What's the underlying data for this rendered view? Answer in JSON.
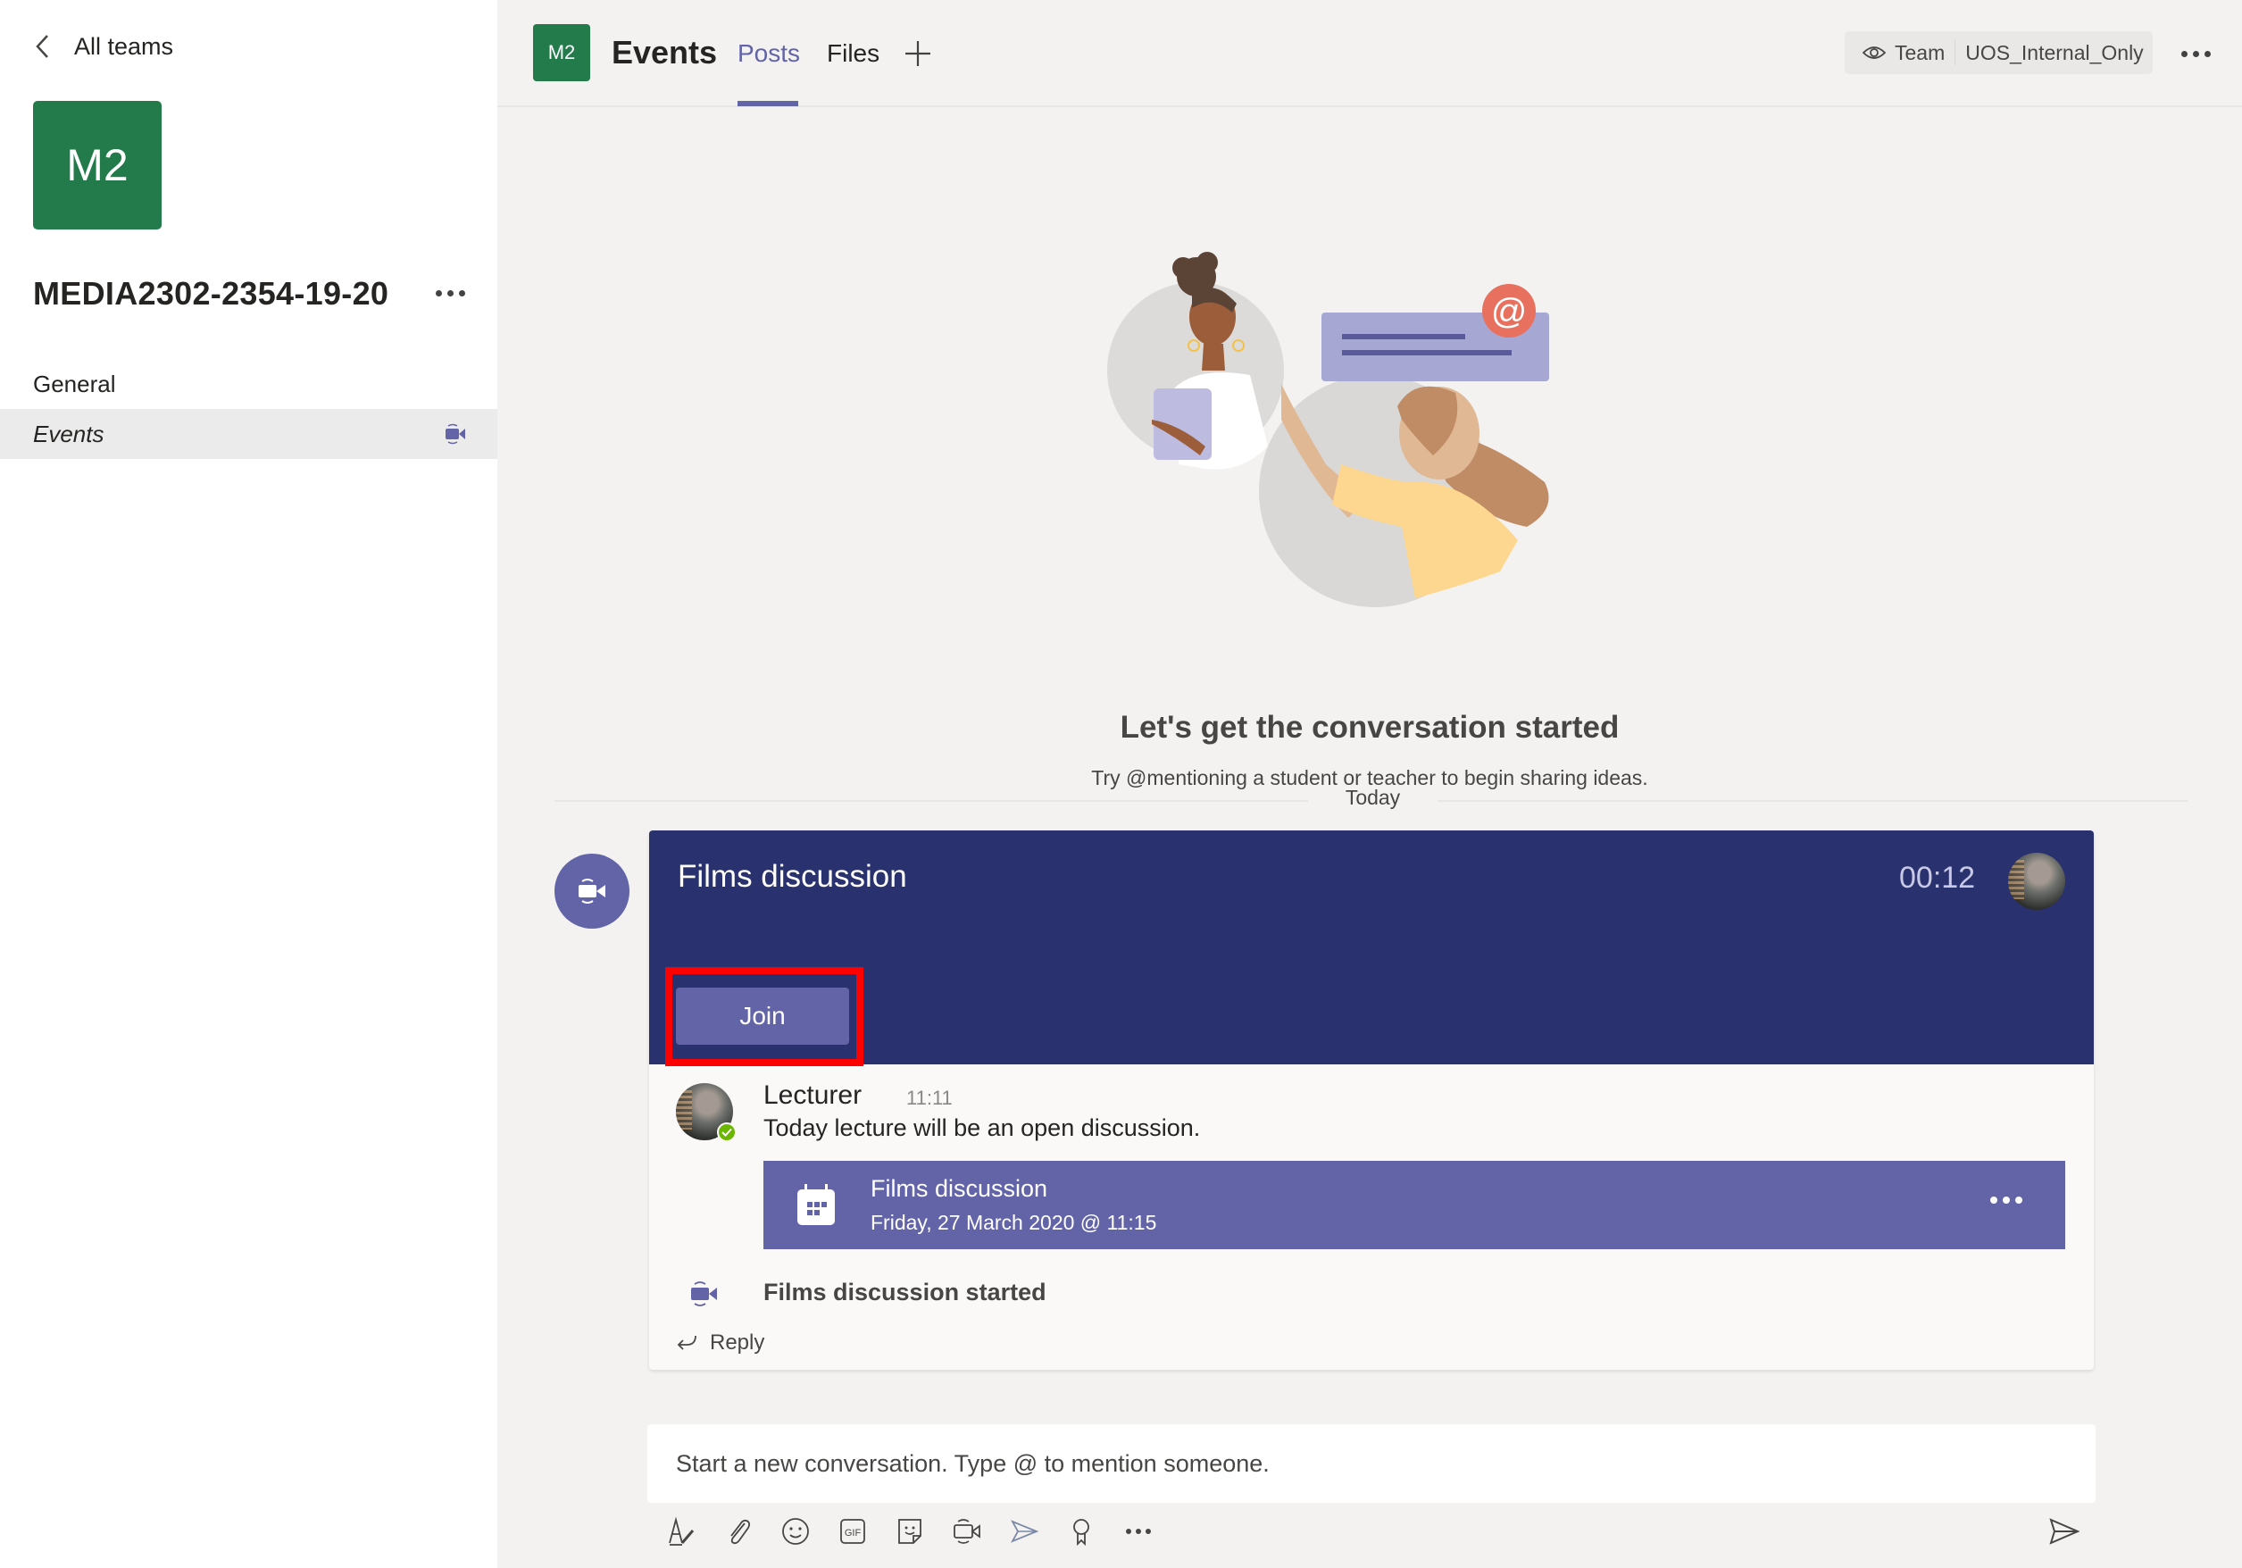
{
  "sidebar": {
    "back_label": "All teams",
    "team_avatar_initials": "M2",
    "team_avatar_color": "#237b4b",
    "team_name": "MEDIA2302-2354-19-20",
    "channels": [
      {
        "label": "General",
        "active": false,
        "meeting_active": false
      },
      {
        "label": "Events",
        "active": true,
        "meeting_active": true
      }
    ]
  },
  "header": {
    "channel_avatar_initials": "M2",
    "channel_title": "Events",
    "tabs": [
      {
        "label": "Posts",
        "active": true
      },
      {
        "label": "Files",
        "active": false
      }
    ],
    "add_tab_icon": "plus-icon",
    "team_pill": {
      "icon": "eye-icon",
      "team_label": "Team",
      "classification": "UOS_Internal_Only"
    },
    "more_icon": "more-horizontal-icon"
  },
  "welcome": {
    "title": "Let's get the conversation started",
    "subtitle": "Try @mentioning a student or teacher to begin sharing ideas.",
    "date_divider": "Today"
  },
  "meeting": {
    "title": "Films discussion",
    "elapsed": "00:12",
    "join_label": "Join",
    "accent_color": "#6264a7",
    "header_color": "#29326f",
    "highlight_color": "#ff0000"
  },
  "message": {
    "author": "Lecturer",
    "time": "11:11",
    "presence": "available",
    "text": "Today lecture will be an open discussion.",
    "event": {
      "title": "Films discussion",
      "datetime": "Friday, 27 March 2020 @ 11:15"
    },
    "system_text": "Films discussion started",
    "reply_label": "Reply"
  },
  "compose": {
    "placeholder": "Start a new conversation. Type @ to mention someone.",
    "value": "",
    "tools": [
      "format-icon",
      "attach-icon",
      "emoji-icon",
      "gif-icon",
      "sticker-icon",
      "meet-now-icon",
      "stream-icon",
      "praise-icon",
      "more-icon"
    ],
    "send_icon": "send-icon"
  }
}
